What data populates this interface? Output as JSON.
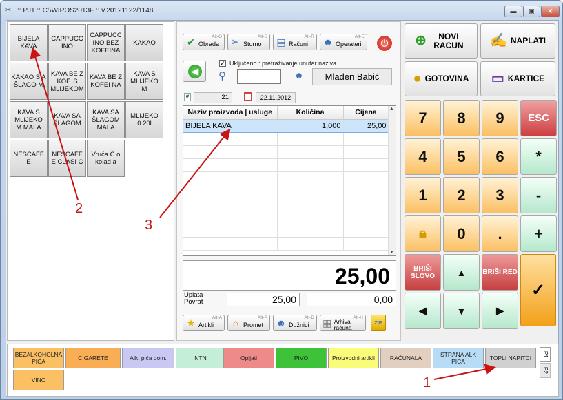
{
  "window": {
    "title": ":: PJ1 :: C:\\WIPOS2013F :: v.20121122/1148",
    "min_glyph": "▬",
    "max_glyph": "▣",
    "close_glyph": "✕"
  },
  "products": [
    {
      "label": "BIJELA KAVA"
    },
    {
      "label": "CAPPUCC INO"
    },
    {
      "label": "CAPPUCC INO BEZ KOFEINA"
    },
    {
      "label": "KAKAO"
    },
    {
      "label": "KAKAO S A ŠLAGO M"
    },
    {
      "label": "KAVA BE Z KOF. S MLIJEKOM"
    },
    {
      "label": "KAVA BE Z KOFEI NA"
    },
    {
      "label": "KAVA S MLIJEKO M"
    },
    {
      "label": "KAVA S MLIJEKO M MALA"
    },
    {
      "label": "KAVA SA ŠLAGOM"
    },
    {
      "label": "KAVA SA ŠLAGOM MALA"
    },
    {
      "label": "MLIJEKO 0.20l"
    },
    {
      "label": "NESCAFF E"
    },
    {
      "label": "NESCAFF E CLASI C"
    },
    {
      "label": "Vruća Č o kolad a"
    }
  ],
  "toolbar_top": [
    {
      "label": "Obrada",
      "shortcut": "Alt-O",
      "icon": "check-icon"
    },
    {
      "label": "Storno",
      "shortcut": "Alt-S",
      "icon": "scissors-icon"
    },
    {
      "label": "Računi",
      "shortcut": "Alt-R",
      "icon": "documents-icon"
    },
    {
      "label": "Operateri",
      "shortcut": "Alt-E",
      "icon": "users-icon"
    }
  ],
  "toolbar_bottom": [
    {
      "label": "Artikli",
      "shortcut": "Alt-A",
      "icon": "star-icon"
    },
    {
      "label": "Promet",
      "shortcut": "Alt-P",
      "icon": "house-icon"
    },
    {
      "label": "Dužnici",
      "shortcut": "Alt-D",
      "icon": "users-icon"
    },
    {
      "label": "Arhiva računa",
      "shortcut": "Alt-H",
      "icon": "archive-icon"
    }
  ],
  "search": {
    "checkbox_label": "Uključeno : pretraživanje unutar naziva",
    "checked": true,
    "value": ""
  },
  "operator": "Mladen Babić",
  "document": {
    "number": "21",
    "date": "22.11.2012"
  },
  "grid": {
    "columns": [
      "Naziv proizvoda | usluge",
      "Količina",
      "Cijena"
    ],
    "rows": [
      {
        "name": "BIJELA KAVA",
        "qty": "1,000",
        "price": "25,00"
      }
    ],
    "empty_rows": 9
  },
  "total": "25,00",
  "payment": {
    "uplata_label": "Uplata",
    "povrat_label": "Povrat",
    "uplata": "25,00",
    "povrat": "0,00"
  },
  "actions": {
    "novi_racun": "NOVI RACUN",
    "naplati": "NAPLATI",
    "gotovina": "GOTOVINA",
    "kartice": "KARTICE"
  },
  "keypad": {
    "keys": [
      "7",
      "8",
      "9",
      "ESC",
      "4",
      "5",
      "6",
      "*",
      "1",
      "2",
      "3",
      "-",
      "0",
      ".",
      "+"
    ],
    "brisi_slovo": "BRIŠI SLOVO",
    "brisi_red": "BRIŠI RED",
    "enter": "✓"
  },
  "groups": [
    {
      "label": "BEZALKOHOLNA PIĆA",
      "color": "#fbc063"
    },
    {
      "label": "CIGARETE",
      "color": "#f9ad55"
    },
    {
      "label": "Alk. pića dom.",
      "color": "#c8c8f2"
    },
    {
      "label": "NTN",
      "color": "#c4efd6"
    },
    {
      "label": "Opijati",
      "color": "#ef8a8a"
    },
    {
      "label": "PIVO",
      "color": "#3ec23a"
    },
    {
      "label": "Proizvodni artikli",
      "color": "#fbfb7a"
    },
    {
      "label": "RAČUNALA",
      "color": "#e3cfc0"
    },
    {
      "label": "STRANA ALK PIĆA",
      "color": "#b9dcf6"
    },
    {
      "label": "TOPLI NAPITCI",
      "color": "#d0d0d0"
    },
    {
      "label": "VINO",
      "color": "#fbc063"
    }
  ],
  "group_tabs": [
    "P1",
    "P2"
  ],
  "annotations": [
    "1",
    "2",
    "3"
  ]
}
